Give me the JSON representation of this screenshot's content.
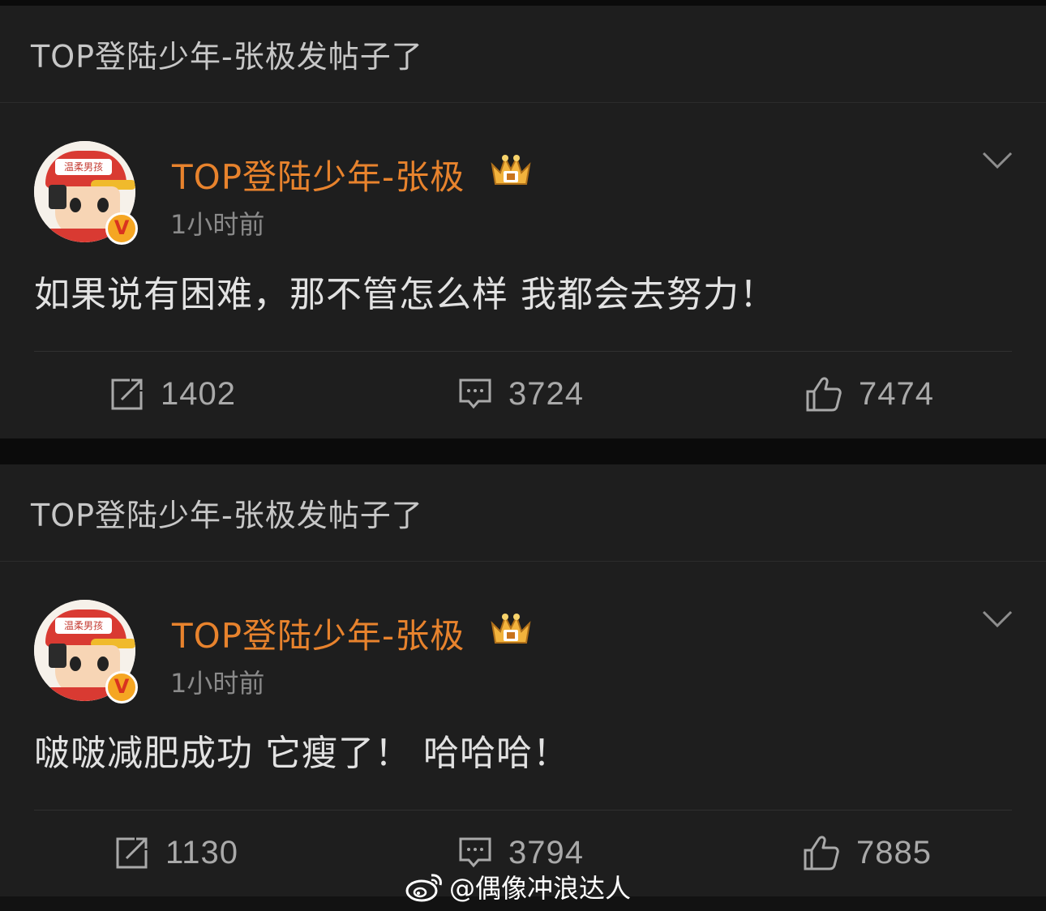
{
  "posts": [
    {
      "header_title": "TOP登陆少年-张极发帖子了",
      "username": "TOP登陆少年-张极",
      "time": "1小时前",
      "text": "如果说有困难，那不管怎么样 我都会去努力！",
      "reposts": "1402",
      "comments": "3724",
      "likes": "7474",
      "avatar_cap_text": "温柔男孩",
      "badge": "V"
    },
    {
      "header_title": "TOP登陆少年-张极发帖子了",
      "username": "TOP登陆少年-张极",
      "time": "1小时前",
      "text": "啵啵减肥成功 它瘦了！ 哈哈哈！",
      "reposts": "1130",
      "comments": "3794",
      "likes": "7885",
      "avatar_cap_text": "温柔男孩",
      "badge": "V"
    }
  ],
  "watermark": {
    "text": "@偶像冲浪达人",
    "icon": "weibo-logo-icon"
  },
  "colors": {
    "background": "#0b0b0b",
    "card": "#1e1e1e",
    "username": "#e8832d",
    "muted": "#8a8a8a",
    "badge": "#f5a623"
  }
}
